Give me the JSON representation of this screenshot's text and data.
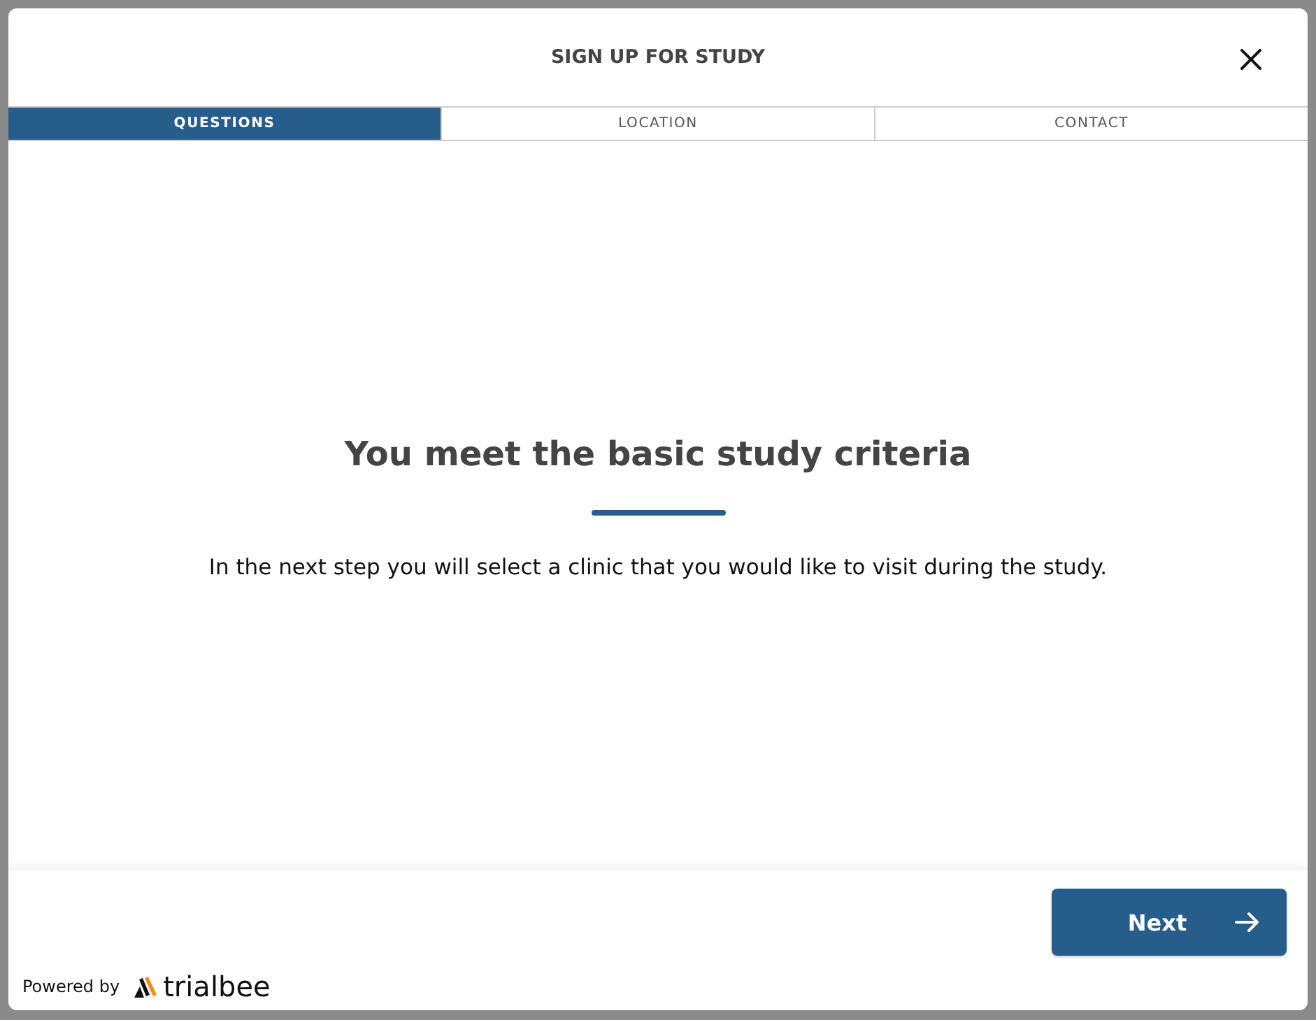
{
  "dialog": {
    "title": "SIGN UP FOR STUDY"
  },
  "steps": [
    {
      "label": "QUESTIONS",
      "selected": true
    },
    {
      "label": "LOCATION",
      "selected": false
    },
    {
      "label": "CONTACT",
      "selected": false
    }
  ],
  "message": {
    "heading": "You meet the basic study criteria",
    "body": "In the next step you will select a clinic that you would like to visit during the study."
  },
  "footer": {
    "next_button": "Next",
    "powered_by": "Powered by",
    "brand": "trialbee"
  }
}
